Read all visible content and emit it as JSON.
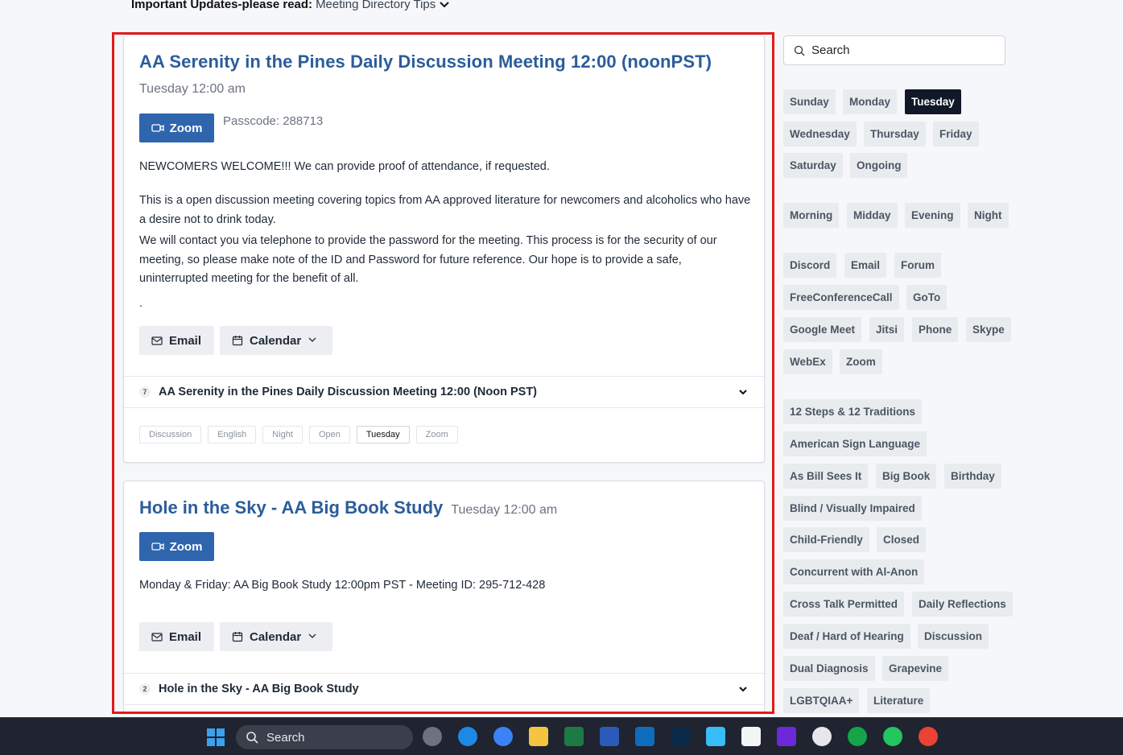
{
  "updates": {
    "label": "Important Updates-please read:",
    "link": "Meeting Directory Tips"
  },
  "meetings": [
    {
      "title": "AA Serenity in the Pines Daily Discussion Meeting 12:00 (noonPST)",
      "time": "Tuesday 12:00 am",
      "zoom_label": "Zoom",
      "passcode": "Passcode: 288713",
      "paragraphs": [
        "NEWCOMERS WELCOME!!! We can provide proof of attendance, if requested.",
        "This is a open discussion meeting covering topics from AA approved literature for newcomers and alcoholics who have a desire not to drink today.",
        "We will contact you via telephone to provide the password for the meeting. This process is for the security of our meeting, so please make note of the ID and Password for future reference. Our hope is to provide a safe, uninterrupted meeting for the benefit of all.",
        "."
      ],
      "email_label": "Email",
      "calendar_label": "Calendar",
      "accordion_count": "7",
      "accordion_title": "AA Serenity in the Pines Daily Discussion Meeting 12:00 (Noon PST)",
      "tags": [
        "Discussion",
        "English",
        "Night",
        "Open",
        "Tuesday",
        "Zoom"
      ],
      "active_tag": "Tuesday"
    },
    {
      "title": "Hole in the Sky - AA Big Book Study",
      "time": "Tuesday 12:00 am",
      "zoom_label": "Zoom",
      "description": "Monday & Friday: AA Big Book Study 12:00pm PST - Meeting ID: 295-712-428",
      "email_label": "Email",
      "calendar_label": "Calendar",
      "accordion_count": "2",
      "accordion_title": "Hole in the Sky - AA Big Book Study"
    }
  ],
  "sidebar": {
    "search_placeholder": "Search",
    "days": [
      "Sunday",
      "Monday",
      "Tuesday",
      "Wednesday",
      "Thursday",
      "Friday",
      "Saturday",
      "Ongoing"
    ],
    "active_day": "Tuesday",
    "times": [
      "Morning",
      "Midday",
      "Evening",
      "Night"
    ],
    "platforms": [
      "Discord",
      "Email",
      "Forum",
      "FreeConferenceCall",
      "GoTo",
      "Google Meet",
      "Jitsi",
      "Phone",
      "Skype",
      "WebEx",
      "Zoom"
    ],
    "types": [
      "12 Steps & 12 Traditions",
      "American Sign Language",
      "As Bill Sees It",
      "Big Book",
      "Birthday",
      "Blind / Visually Impaired",
      "Child-Friendly",
      "Closed",
      "Concurrent with Al-Anon",
      "Cross Talk Permitted",
      "Daily Reflections",
      "Deaf / Hard of Hearing",
      "Discussion",
      "Dual Diagnosis",
      "Grapevine",
      "LGBTQIAA+",
      "Literature"
    ]
  },
  "taskbar": {
    "search_label": "Search"
  }
}
